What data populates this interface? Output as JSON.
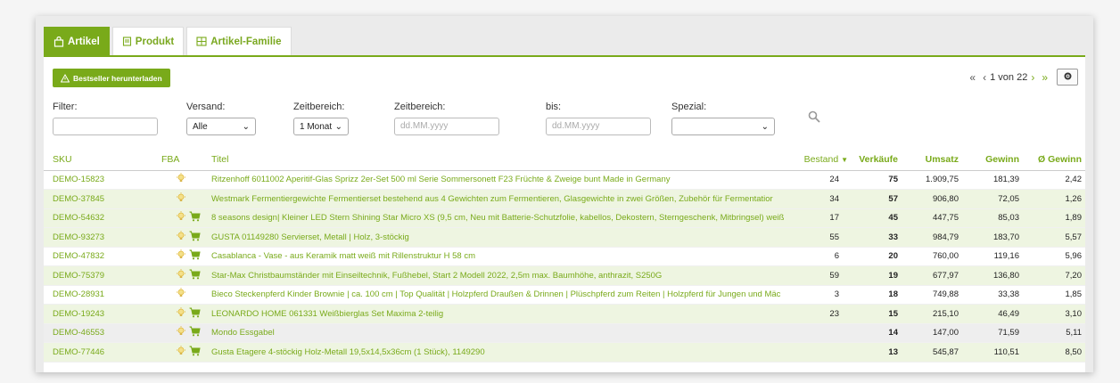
{
  "tabs": [
    {
      "label": "Artikel",
      "icon": "bag-icon",
      "active": true
    },
    {
      "label": "Produkt",
      "icon": "document-icon",
      "active": false
    },
    {
      "label": "Artikel-Familie",
      "icon": "family-icon",
      "active": false
    }
  ],
  "toolbar": {
    "download_label": "Bestseller herunterladen"
  },
  "pager": {
    "first": "«",
    "prev": "‹",
    "page_text": "1 von 22",
    "next": "›",
    "last": "»"
  },
  "filters": {
    "filter_label": "Filter:",
    "versand_label": "Versand:",
    "versand_value": "Alle",
    "zeitbereich_label": "Zeitbereich:",
    "zeitbereich_value": "1 Monat",
    "zeitbereich2_label": "Zeitbereich:",
    "date_placeholder": "dd.MM.yyyy",
    "bis_label": "bis:",
    "bis_placeholder": "dd.MM.yyyy",
    "spezial_label": "Spezial:",
    "spezial_value": ""
  },
  "columns": {
    "sku": "SKU",
    "fba": "FBA",
    "title": "Titel",
    "bestand": "Bestand",
    "verkaeufe": "Verkäufe",
    "umsatz": "Umsatz",
    "gewinn": "Gewinn",
    "avg_gewinn": "Ø Gewinn"
  },
  "rows": [
    {
      "sku": "DEMO-15823",
      "cart": false,
      "title": "Ritzenhoff 6011002 Aperitif-Glas Sprizz 2er-Set 500 ml  Serie Sommersonett F23  Früchte & Zweige bunt  Made in Germany",
      "bestand": "24",
      "verkaeufe": "75",
      "umsatz": "1.909,75",
      "gewinn": "181,39",
      "avg": "2,42"
    },
    {
      "sku": "DEMO-37845",
      "cart": false,
      "title": "Westmark Fermentiergewichte  Fermentierset bestehend aus 4 Gewichten zum Fermentieren, Glasgewichte in zwei Größen, Zubehör für Fermentatior",
      "bestand": "34",
      "verkaeufe": "57",
      "umsatz": "906,80",
      "gewinn": "72,05",
      "avg": "1,26"
    },
    {
      "sku": "DEMO-54632",
      "cart": true,
      "title": "8 seasons design| Kleiner LED Stern Shining Star Micro XS (9,5 cm, Neu mit Batterie-Schutzfolie, kabellos, Dekostern, Sterngeschenk, Mitbringsel) weiß",
      "bestand": "17",
      "verkaeufe": "45",
      "umsatz": "447,75",
      "gewinn": "85,03",
      "avg": "1,89"
    },
    {
      "sku": "DEMO-93273",
      "cart": true,
      "title": "GUSTA 01149280 Servierset, Metall | Holz, 3-stöckig",
      "bestand": "55",
      "verkaeufe": "33",
      "umsatz": "984,79",
      "gewinn": "183,70",
      "avg": "5,57"
    },
    {
      "sku": "DEMO-47832",
      "cart": true,
      "title": "Casablanca - Vase - aus Keramik matt weiß mit Rillenstruktur H 58 cm",
      "bestand": "6",
      "verkaeufe": "20",
      "umsatz": "760,00",
      "gewinn": "119,16",
      "avg": "5,96"
    },
    {
      "sku": "DEMO-75379",
      "cart": true,
      "title": "Star-Max Christbaumständer mit Einseiltechnik, Fußhebel, Start 2 Modell 2022, 2,5m max. Baumhöhe, anthrazit, S250G",
      "bestand": "59",
      "verkaeufe": "19",
      "umsatz": "677,97",
      "gewinn": "136,80",
      "avg": "7,20"
    },
    {
      "sku": "DEMO-28931",
      "cart": false,
      "title": "Bieco Steckenpferd Kinder Brownie | ca. 100 cm | Top Qualität | Holzpferd Draußen & Drinnen | Plüschpferd zum Reiten | Holzpferd für Jungen und Mäc",
      "bestand": "3",
      "verkaeufe": "18",
      "umsatz": "749,88",
      "gewinn": "33,38",
      "avg": "1,85"
    },
    {
      "sku": "DEMO-19243",
      "cart": true,
      "title": "LEONARDO HOME 061331 Weißbierglas Set Maxima 2-teilig",
      "bestand": "23",
      "verkaeufe": "15",
      "umsatz": "215,10",
      "gewinn": "46,49",
      "avg": "3,10"
    },
    {
      "sku": "DEMO-46553",
      "cart": true,
      "title": "Mondo Essgabel",
      "bestand": "",
      "verkaeufe": "14",
      "umsatz": "147,00",
      "gewinn": "71,59",
      "avg": "5,11"
    },
    {
      "sku": "DEMO-77446",
      "cart": true,
      "title": "Gusta Etagere 4-stöckig Holz-Metall 19,5x14,5x36cm (1 Stück), 1149290",
      "bestand": "",
      "verkaeufe": "13",
      "umsatz": "545,87",
      "gewinn": "110,51",
      "avg": "8,50"
    }
  ],
  "colors": {
    "accent": "#79aa1a",
    "row_alt": "#eef5e1",
    "row_dim": "#eeeeee"
  }
}
